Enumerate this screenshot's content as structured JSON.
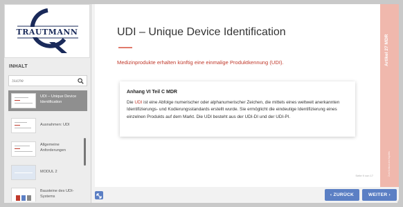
{
  "logo": {
    "text": "TRAUTMANN"
  },
  "sidebar": {
    "heading": "INHALT",
    "search_placeholder": "Suche",
    "items": [
      {
        "label": "UDI – Unique Device Identification",
        "active": true
      },
      {
        "label": "Ausnahmen: UDI",
        "active": false
      },
      {
        "label": "Allgemeine Anforderungen",
        "active": false
      },
      {
        "label": "MODUL 2",
        "active": false
      },
      {
        "label": "Bausteine des UDI-Systems",
        "active": false
      }
    ]
  },
  "main": {
    "title": "UDI – Unique Device Identification",
    "subtitle": "Medizinprodukte erhalten künftig eine einmalige Produktkennung (UDI).",
    "card": {
      "title": "Anhang VI Teil C MDR",
      "text_before": "Die ",
      "link": "UDI",
      "text_after": " ist eine Abfolge numerischer oder alphanumerischer Zeichen, die mittels eines weltweit anerkannten Identifizierungs- und Kodierungsstandards erstellt wurde. Sie ermöglicht die eindeutige Identifizierung eines einzelnen Produkts auf dem Markt. Die UDI besteht aus der UDI-DI und der UDI-PI."
    },
    "page_counter": "Seite 9 von 17"
  },
  "right_strip": {
    "title": "Artikel 27 MDR",
    "small_text": "Zum Schluss des Kapitels"
  },
  "buttons": {
    "back": "‹ ZURÜCK",
    "next": "WEITER ›"
  },
  "colors": {
    "accent": "#5b7fc4",
    "brand_red": "#c0392b",
    "strip": "#f0b8ad"
  }
}
